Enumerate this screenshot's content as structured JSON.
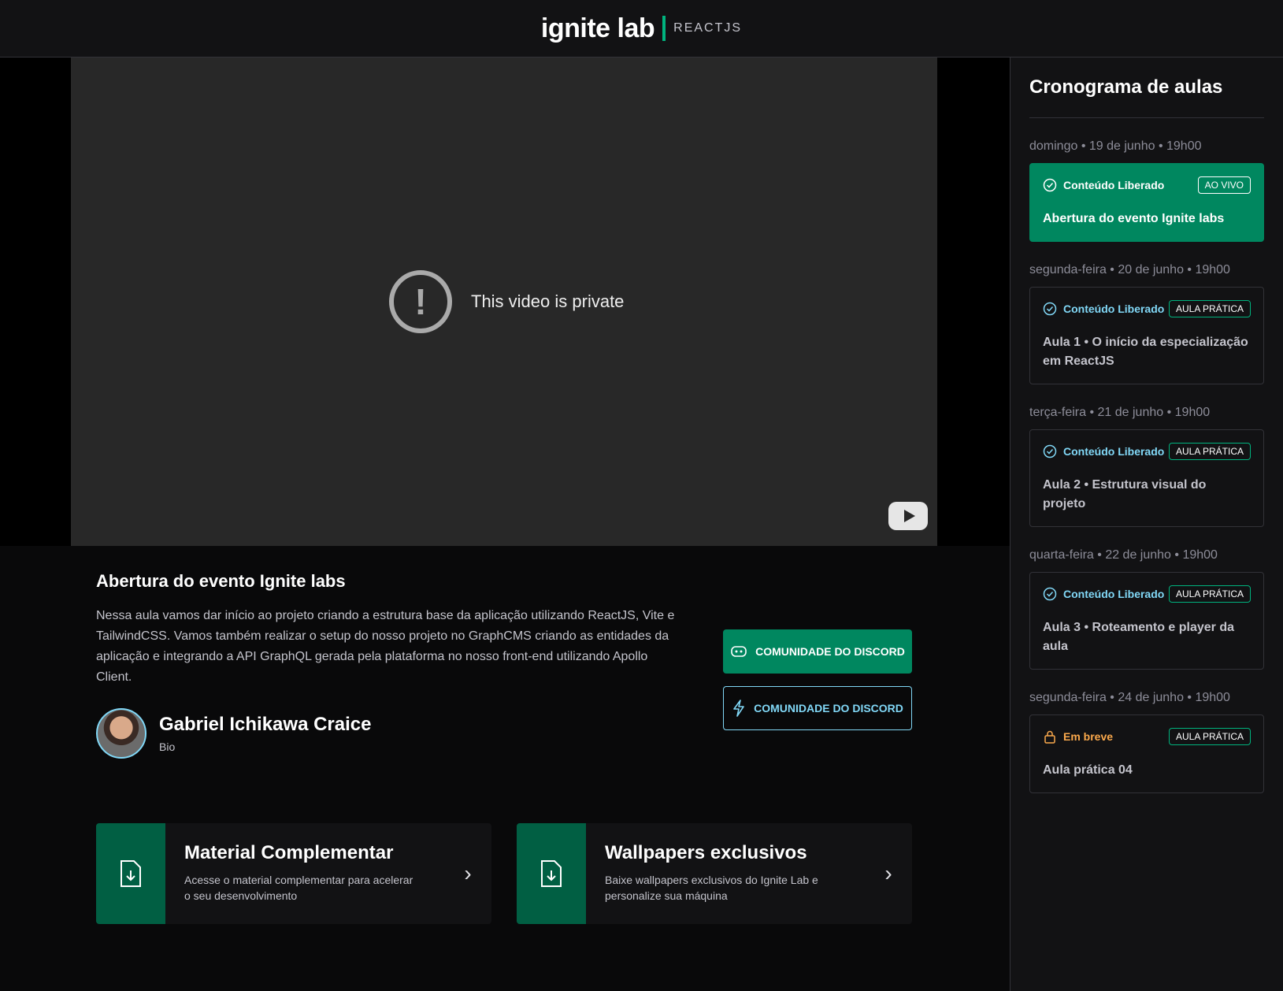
{
  "header": {
    "logo": "ignite lab",
    "subtitle": "REACTJS"
  },
  "video": {
    "message": "This video is private"
  },
  "lesson": {
    "title": "Abertura do evento Ignite labs",
    "description": "Nessa aula vamos dar início ao projeto criando a estrutura base da aplicação utilizando ReactJS, Vite e TailwindCSS. Vamos também realizar o setup do nosso projeto no GraphCMS criando as entidades da aplicação e integrando a API GraphQL gerada pela plataforma no nosso front-end utilizando Apollo Client.",
    "teacher_name": "Gabriel Ichikawa Craice",
    "teacher_bio": "Bio",
    "button_primary": "COMUNIDADE DO DISCORD",
    "button_secondary": "COMUNIDADE DO DISCORD"
  },
  "cards": [
    {
      "title": "Material Complementar",
      "description": "Acesse o material complementar para acelerar o seu desenvolvimento"
    },
    {
      "title": "Wallpapers exclusivos",
      "description": "Baixe wallpapers exclusivos do Ignite Lab e personalize sua máquina"
    }
  ],
  "sidebar": {
    "title": "Cronograma de aulas",
    "lessons": [
      {
        "date": "domingo • 19 de junho • 19h00",
        "status": "Conteúdo Liberado",
        "tag": "AO VIVO",
        "title": "Abertura do evento Ignite labs"
      },
      {
        "date": "segunda-feira • 20 de junho • 19h00",
        "status": "Conteúdo Liberado",
        "tag": "AULA PRÁTICA",
        "title": "Aula 1 • O início da especialização em ReactJS"
      },
      {
        "date": "terça-feira • 21 de junho • 19h00",
        "status": "Conteúdo Liberado",
        "tag": "AULA PRÁTICA",
        "title": "Aula 2 • Estrutura visual do projeto"
      },
      {
        "date": "quarta-feira • 22 de junho • 19h00",
        "status": "Conteúdo Liberado",
        "tag": "AULA PRÁTICA",
        "title": "Aula 3 • Roteamento e player da aula"
      },
      {
        "date": "segunda-feira • 24 de junho • 19h00",
        "status": "Em breve",
        "tag": "AULA PRÁTICA",
        "title": "Aula prática 04"
      }
    ]
  },
  "colors": {
    "brand_green": "#00875F",
    "accent_blue": "#81D8F7",
    "warning_orange": "#FBA94C"
  }
}
